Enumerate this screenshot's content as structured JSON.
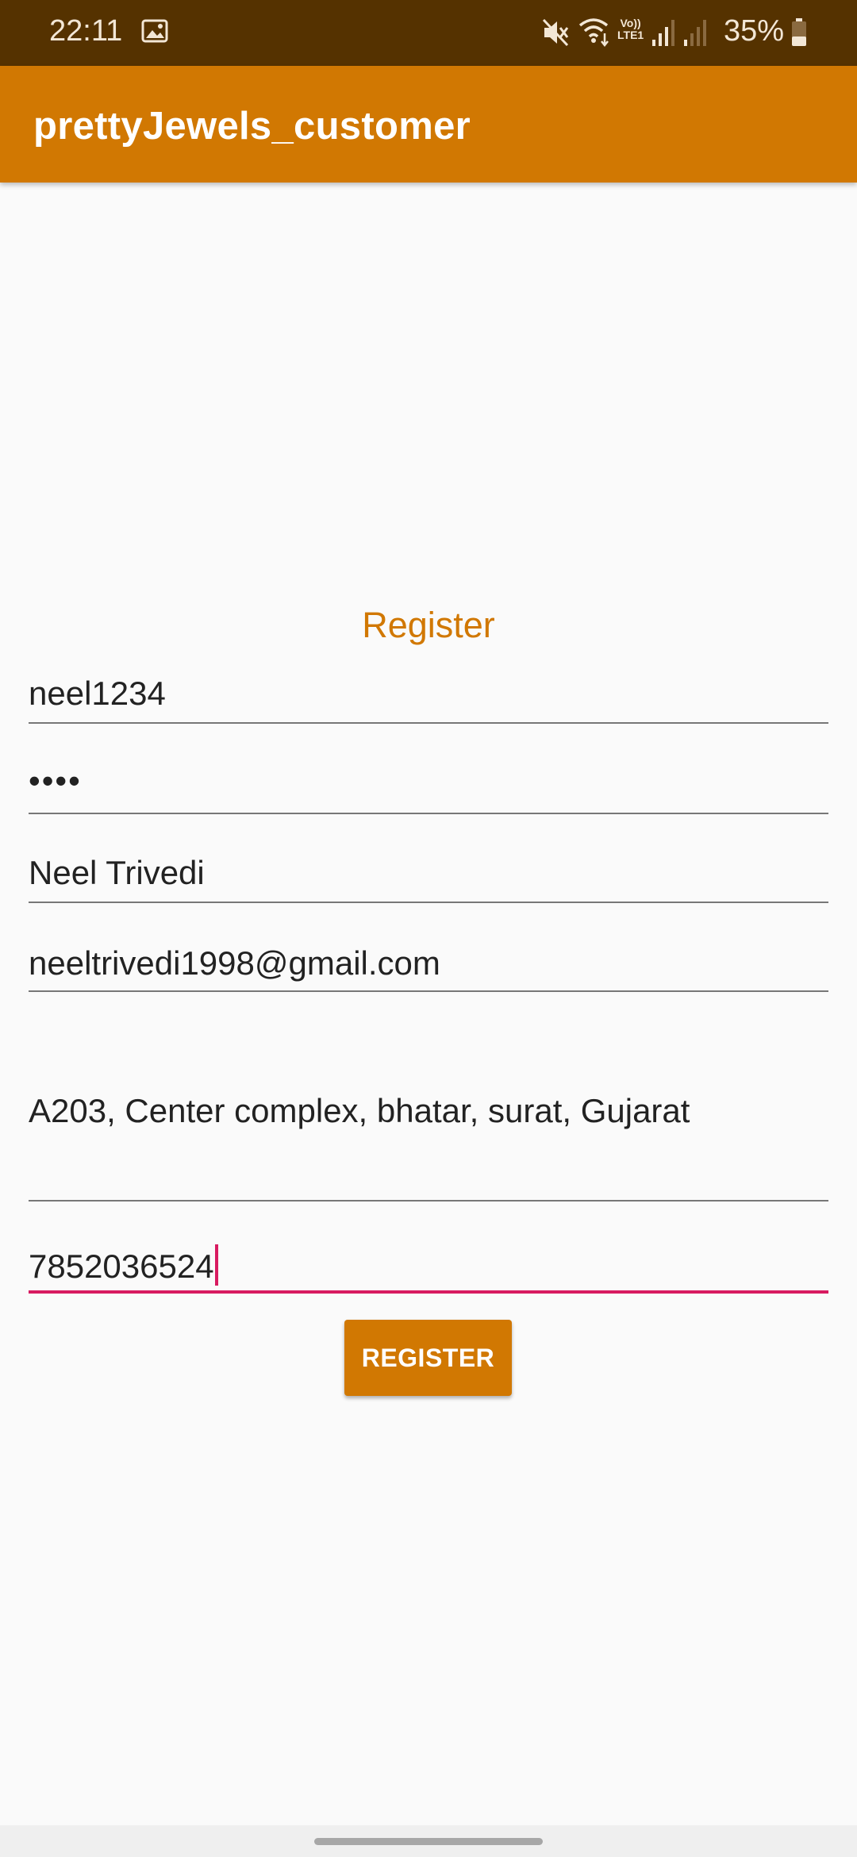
{
  "status_bar": {
    "time": "22:11",
    "volte_line1": "Vo))",
    "volte_line2": "LTE1",
    "battery": "35%",
    "icons": [
      "gallery-icon",
      "mute-icon",
      "wifi-icon",
      "volte-icon",
      "signal-icon",
      "signal-icon",
      "battery-icon"
    ]
  },
  "app_bar": {
    "title": "prettyJewels_customer"
  },
  "form": {
    "heading": "Register",
    "username": "neel1234",
    "password_mask": "••••",
    "name": "Neel Trivedi",
    "email": "neeltrivedi1998@gmail.com",
    "address": "A203, Center complex, bhatar, surat, Gujarat",
    "phone": "7852036524",
    "submit_label": "REGISTER"
  },
  "colors": {
    "status_bar": "#553200",
    "accent": "#d17802",
    "focus": "#d81b60",
    "background": "#fafafa"
  }
}
